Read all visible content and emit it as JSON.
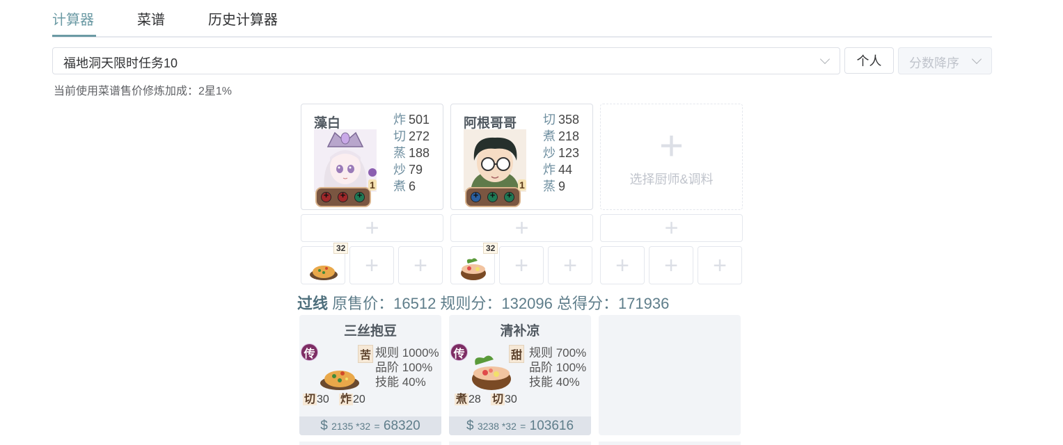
{
  "tabs": [
    "计算器",
    "菜谱",
    "历史计算器"
  ],
  "task_select": {
    "value": "福地洞天限时任务10"
  },
  "personal_button": "个人",
  "sort_select": {
    "value": "分数降序"
  },
  "bonus_text": "当前使用菜谱售价修炼加成：2星1%",
  "chefs": [
    {
      "name": "藻白",
      "level": "1",
      "skills": [
        {
          "type": "炸",
          "value": "501"
        },
        {
          "type": "切",
          "value": "272"
        },
        {
          "type": "蒸",
          "value": "188"
        },
        {
          "type": "炒",
          "value": "79"
        },
        {
          "type": "煮",
          "value": "6"
        }
      ],
      "recipe_qty": "32"
    },
    {
      "name": "阿根哥哥",
      "level": "1",
      "skills": [
        {
          "type": "切",
          "value": "358"
        },
        {
          "type": "煮",
          "value": "218"
        },
        {
          "type": "炒",
          "value": "123"
        },
        {
          "type": "炸",
          "value": "44"
        },
        {
          "type": "蒸",
          "value": "9"
        }
      ],
      "recipe_qty": "32"
    }
  ],
  "add_chef_label": "选择厨师&调料",
  "summary": {
    "status": "过线",
    "text": "原售价：16512 规则分：132096 总得分：171936"
  },
  "recipes": [
    {
      "name": "三丝抱豆",
      "rarity": "传",
      "flavor": "苦",
      "rule": "规则 1000%",
      "grade": "品阶 100%",
      "skill": "技能 40%",
      "req1_type": "切",
      "req1_val": "30",
      "req2_type": "炸",
      "req2_val": "20",
      "price_unit": "2135 *32",
      "price_total": "68320"
    },
    {
      "name": "清补凉",
      "rarity": "传",
      "flavor": "甜",
      "rule": "规则 700%",
      "grade": "品阶 100%",
      "skill": "技能 40%",
      "req1_type": "煮",
      "req1_val": "28",
      "req2_type": "切",
      "req2_val": "30",
      "price_unit": "3238 *32",
      "price_total": "103616"
    }
  ],
  "colors": {
    "accent": "#6b9aa4",
    "rarity": "#7d2d63"
  },
  "icons": [
    "plus-icon",
    "chevron-down-icon"
  ]
}
